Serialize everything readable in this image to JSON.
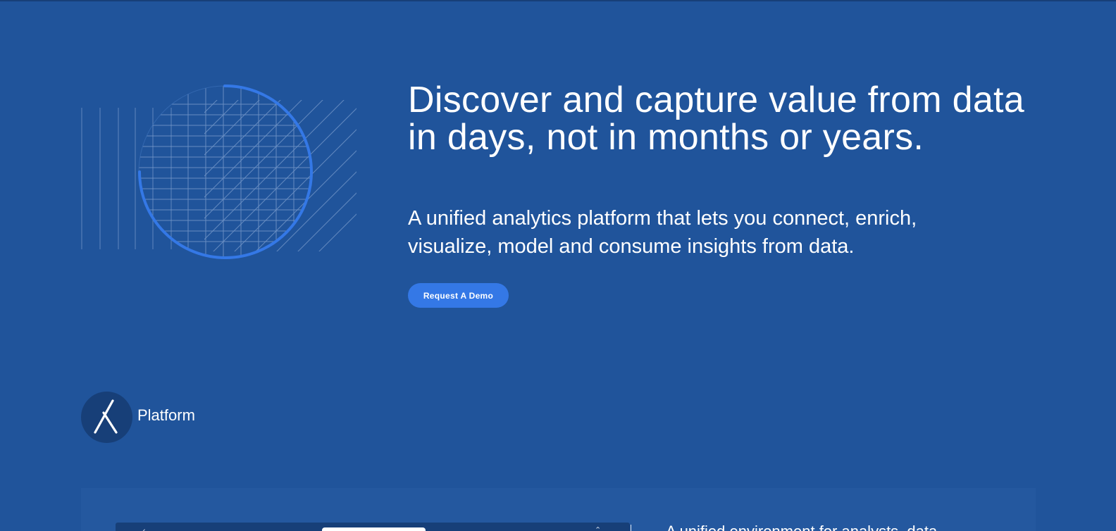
{
  "hero": {
    "title_line1": "Discover and capture value from data",
    "title_line2": "in days, not in months or years.",
    "subtitle_line1": "A unified analytics platform that lets you connect, enrich,",
    "subtitle_line2": "visualize, model and consume insights from data.",
    "cta_label": "Request A Demo",
    "graphic_icon": "grid-circle-illustration"
  },
  "platform": {
    "logo_icon": "x-logo-icon",
    "label": "Platform"
  },
  "feature_panel": {
    "text": "A unified environment for analysts, data",
    "preview_icons": [
      "chevron-left-icon",
      "url-bar",
      "chevron-toggle-icon"
    ]
  },
  "colors": {
    "background": "#20549b",
    "accent": "#3478e6",
    "dark": "#173f78",
    "panel": "#24589f"
  }
}
